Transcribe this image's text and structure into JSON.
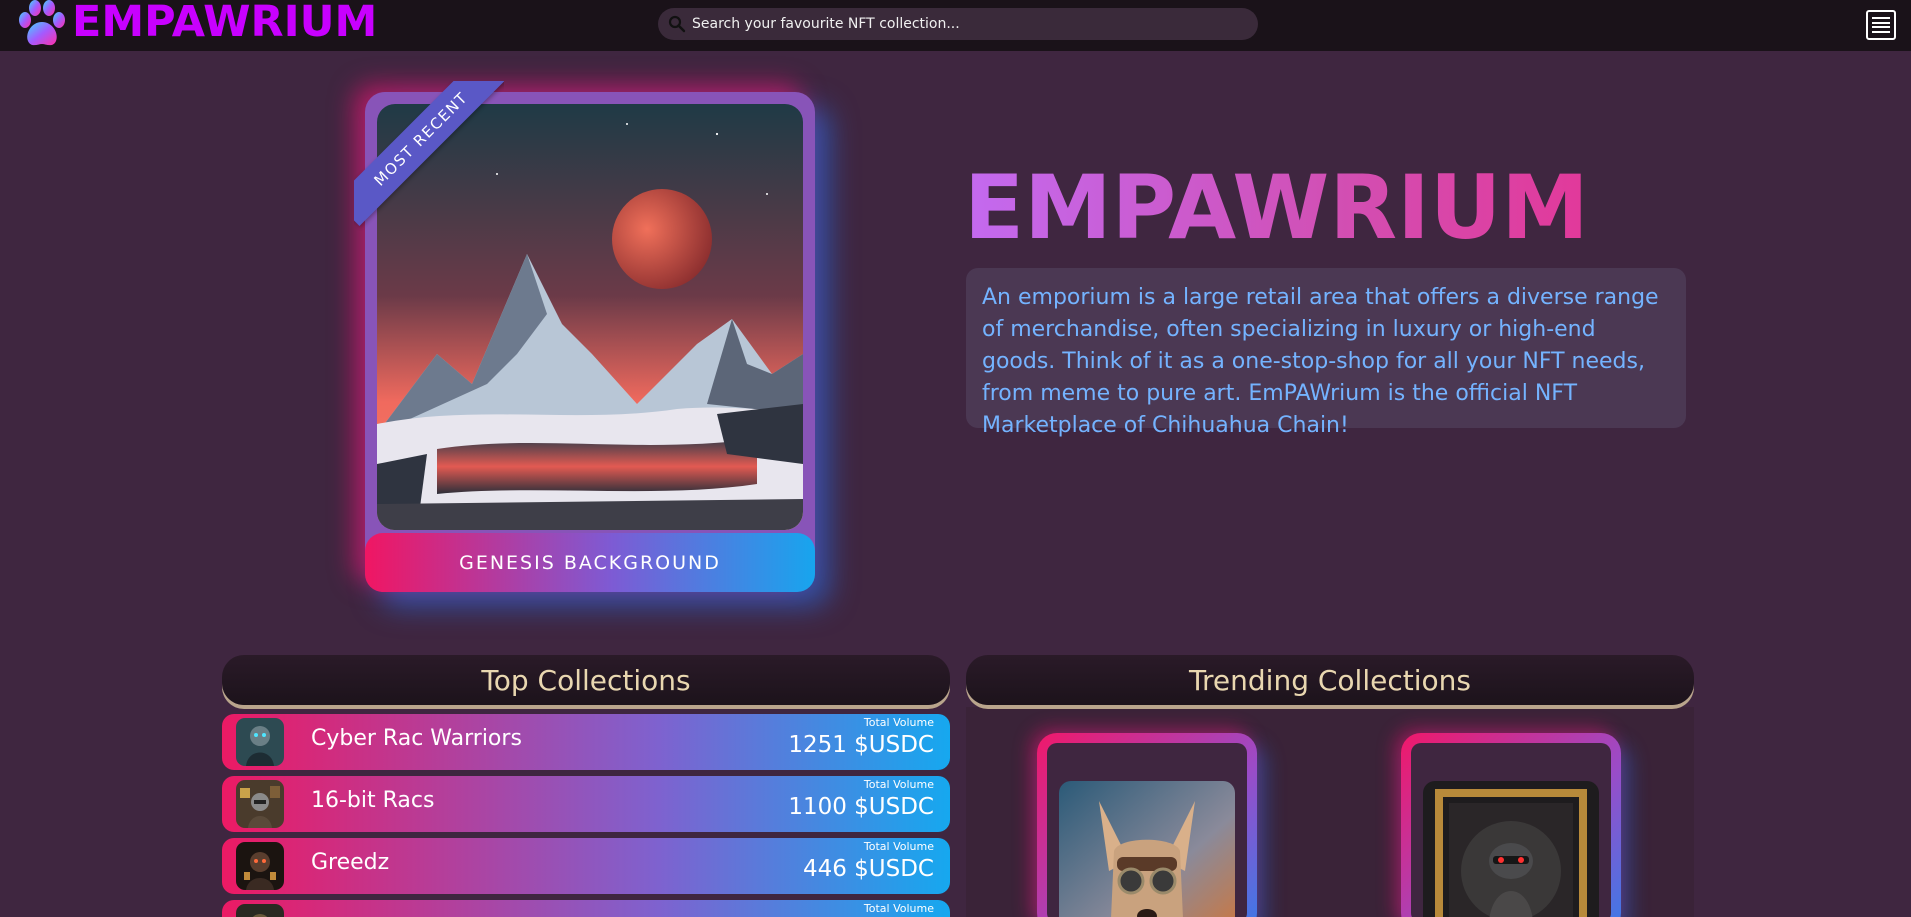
{
  "brand": {
    "name": "EMPAWRIUM"
  },
  "search": {
    "placeholder": "Search your favourite NFT collection..."
  },
  "featured": {
    "ribbon": "MOST RECENT",
    "name": "GENESIS BACKGROUND"
  },
  "hero": {
    "title": "EMPAWRIUM",
    "description": "An emporium is a large retail area that offers a diverse range of merchandise, often specializing in luxury or high-end goods. Think of it as a one-stop-shop for all your NFT needs, from meme to pure art. EmPAWrium is the official NFT Marketplace of Chihuahua Chain!"
  },
  "top_collections": {
    "title": "Top Collections",
    "volume_label": "Total Volume",
    "items": [
      {
        "name": "Cyber Rac Warriors",
        "volume": "1251 $USDC"
      },
      {
        "name": "16-bit Racs",
        "volume": "1100 $USDC"
      },
      {
        "name": "Greedz",
        "volume": "446 $USDC"
      },
      {
        "name": "",
        "volume": ""
      }
    ]
  },
  "trending_collections": {
    "title": "Trending Collections"
  },
  "colors": {
    "background": "#3f2640",
    "topbar": "#1a1219",
    "brand": "#c800ff",
    "accent_pink": "#ec1a64",
    "accent_blue": "#16a8ef",
    "desc_text": "#74b3ff",
    "panel_title": "#e9d7b0"
  },
  "icons": [
    "paw-logo-icon",
    "search-icon",
    "menu-icon"
  ]
}
